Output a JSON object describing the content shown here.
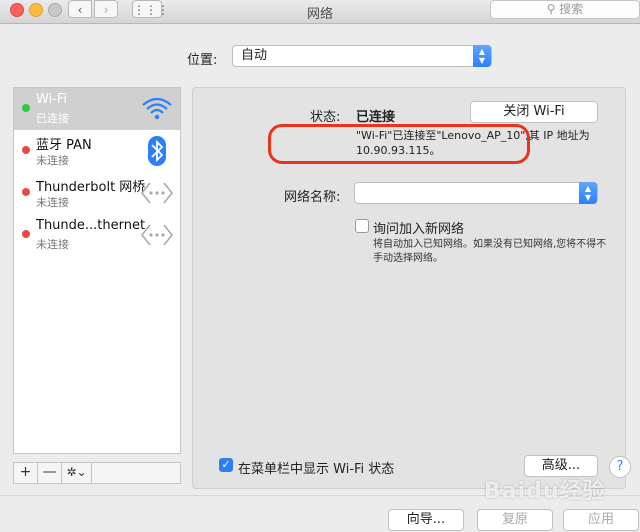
{
  "window": {
    "title": "网络",
    "search_placeholder": "搜索"
  },
  "location": {
    "label": "位置:",
    "value": "自动"
  },
  "sidebar": {
    "services": [
      {
        "name": "Wi-Fi",
        "status": "已连接",
        "dot": "green",
        "icon": "wifi-icon",
        "selected": true
      },
      {
        "name": "蓝牙 PAN",
        "status": "未连接",
        "dot": "red",
        "icon": "bluetooth-icon"
      },
      {
        "name": "Thunderbolt 网桥",
        "status": "未连接",
        "dot": "red",
        "icon": "network-bridge-icon"
      },
      {
        "name": "Thunde...thernet",
        "status": "未连接",
        "dot": "red",
        "icon": "ethernet-icon"
      }
    ],
    "footer": {
      "add": "+",
      "remove": "—",
      "actions": "✲⌄"
    }
  },
  "detail": {
    "status_label": "状态:",
    "status_value": "已连接",
    "wifi_off_button": "关闭 Wi-Fi",
    "status_desc_line1": "\"Wi-Fi\"已连接至\"Lenovo_AP_10\",其 IP 地址为",
    "status_desc_line2": "10.90.93.115。",
    "network_name_label": "网络名称:",
    "network_name_value": "",
    "ask_join_label": "询问加入新网络",
    "ask_join_desc": "将自动加入已知网络。如果没有已知网络,您将不得不手动选择网络。",
    "show_in_menubar_label": "在菜单栏中显示 Wi-Fi 状态",
    "advanced_button": "高级...",
    "help_button": "?"
  },
  "bottom": {
    "assist": "向导...",
    "revert": "复原",
    "apply": "应用"
  },
  "watermark": "Baidu经验",
  "colors": {
    "annotation": "#e8341c",
    "accent": "#2d7ff9",
    "connected": "#2ecc40",
    "disconnected": "#e84a4a"
  }
}
